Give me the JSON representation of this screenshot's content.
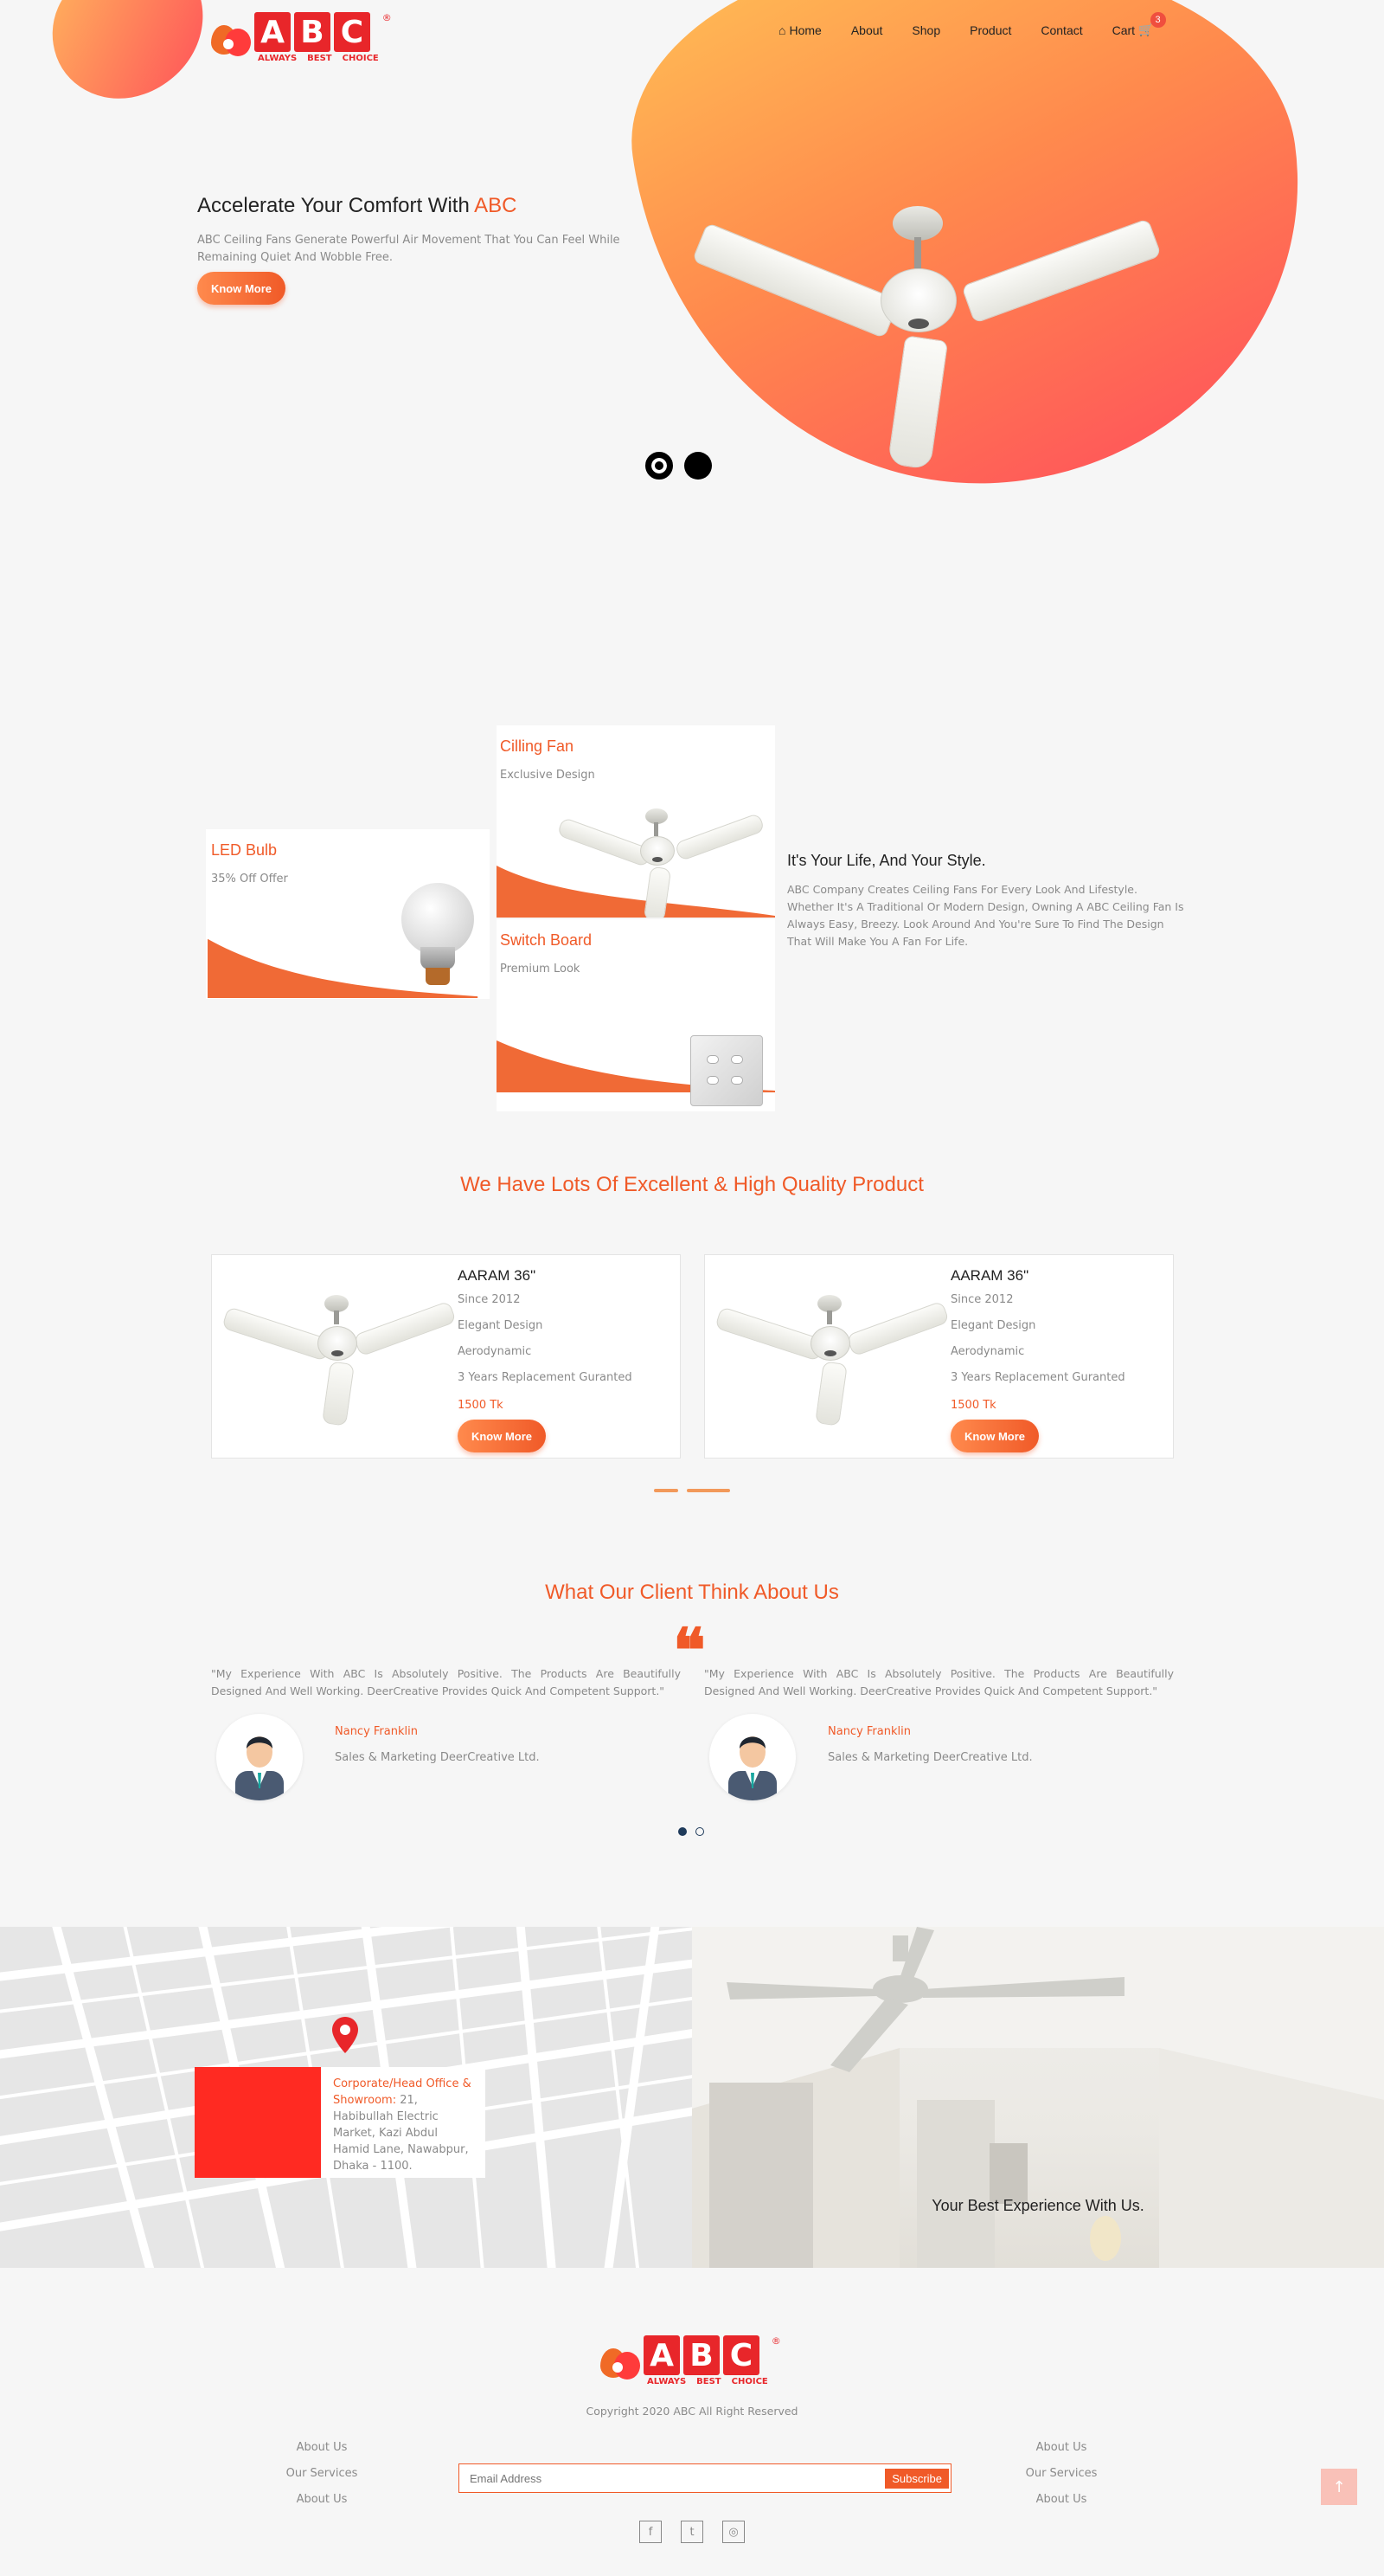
{
  "brand": {
    "letters": [
      "A",
      "B",
      "C"
    ],
    "tagline": [
      "ALWAYS",
      "BEST",
      "CHOICE"
    ],
    "registered": "®"
  },
  "nav": {
    "items": [
      {
        "label": "Home",
        "icon": "home-icon"
      },
      {
        "label": "About"
      },
      {
        "label": "Shop"
      },
      {
        "label": "Product"
      },
      {
        "label": "Contact"
      },
      {
        "label": "Cart",
        "icon": "cart-icon"
      }
    ],
    "cart_count": "3"
  },
  "hero": {
    "title_prefix": "Accelerate Your Comfort With ",
    "title_brand": "ABC",
    "description": "ABC Ceiling Fans Generate Powerful Air Movement That You Can Feel While Remaining Quiet And Wobble Free.",
    "button": "Know More",
    "slide_count": 2,
    "active_slide": 1
  },
  "features": {
    "ceiling_fan": {
      "title": "Cilling Fan",
      "subtitle": "Exclusive Design"
    },
    "led_bulb": {
      "title": "LED Bulb",
      "subtitle": "35% Off Offer"
    },
    "switch_board": {
      "title": "Switch Board",
      "subtitle": "Premium Look"
    },
    "style_title": "It's Your Life, And Your Style.",
    "style_description": "ABC Company Creates Ceiling Fans For Every Look And Lifestyle. Whether It's A Traditional Or Modern Design, Owning A ABC Ceiling Fan Is Always Easy, Breezy. Look Around And You're Sure To Find The Design That Will Make You A Fan For Life."
  },
  "products": {
    "heading": "We Have Lots Of Excellent & High Quality Product",
    "items": [
      {
        "name": "AARAM 36\"",
        "since": "Since 2012",
        "f1": "Elegant Design",
        "f2": "Aerodynamic",
        "f3": "3 Years Replacement Guranted",
        "price": "1500 Tk",
        "button": "Know More"
      },
      {
        "name": "AARAM 36\"",
        "since": "Since 2012",
        "f1": "Elegant Design",
        "f2": "Aerodynamic",
        "f3": "3 Years Replacement Guranted",
        "price": "1500 Tk",
        "button": "Know More"
      }
    ]
  },
  "testimonials": {
    "heading": "What Our Client Think About Us",
    "items": [
      {
        "quote": "\"My Experience With ABC Is Absolutely Positive. The Products Are Beautifully Designed And Well Working. DeerCreative Provides Quick And Competent Support.\"",
        "name": "Nancy Franklin",
        "role": "Sales & Marketing DeerCreative Ltd."
      },
      {
        "quote": "\"My Experience With ABC Is Absolutely Positive. The Products Are Beautifully Designed And Well Working. DeerCreative Provides Quick And Competent Support.\"",
        "name": "Nancy Franklin",
        "role": "Sales & Marketing DeerCreative Ltd."
      }
    ],
    "active_slide": 1
  },
  "office": {
    "label": "Corporate/Head Office & Showroom:",
    "address": " 21, Habibullah Electric Market, Kazi Abdul Hamid Lane, Nawabpur, Dhaka - 1100.",
    "experience": "Your Best Experience With Us."
  },
  "footer": {
    "copyright": "Copyright 2020 ABC All Right Reserved",
    "left_links": [
      "About Us",
      "Our Services",
      "About Us"
    ],
    "right_links": [
      "About Us",
      "Our Services",
      "About Us"
    ],
    "email_placeholder": "Email Address",
    "subscribe": "Subscribe",
    "social": [
      "facebook-icon",
      "twitter-icon",
      "instagram-icon"
    ],
    "social_glyphs": [
      "f",
      "t",
      "◎"
    ],
    "to_top": "↑"
  },
  "colors": {
    "accent": "#f05a28",
    "brand_red": "#e8262a",
    "gradient_start": "#ffbe55",
    "gradient_end": "#ff4e5c"
  }
}
